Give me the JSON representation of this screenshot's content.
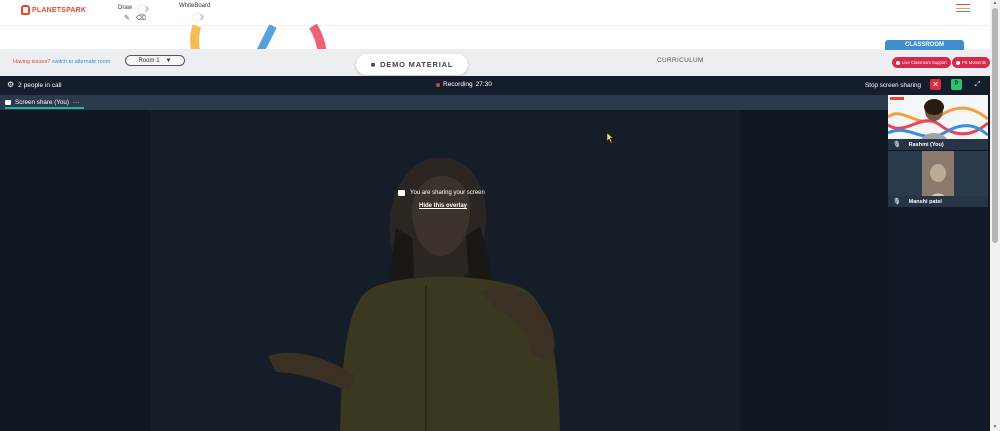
{
  "topbar": {
    "logo_text": "PLANETSPARK",
    "draw_label": "Draw",
    "whiteboard_label": "WhiteBoard",
    "tools": [
      "pencil-icon",
      "eraser-icon"
    ],
    "menu_colors": [
      "#e8452c",
      "#f2a03d",
      "#3a8fd6"
    ]
  },
  "roombar": {
    "issues_text": "Having issues?",
    "alternate_link": "switch to alternate room",
    "room_select": "Room 1",
    "demo_material": "DEMO MATERIAL",
    "curriculum": "CURRICULUM",
    "classroom_tab": "CLASSROOM",
    "live_support": "Live Classroom Support",
    "ps_moments": "PS Moments"
  },
  "call": {
    "people_count": "2 people in call",
    "recording_label": "Recording",
    "recording_time": "27:30",
    "stop_sharing": "Stop screen sharing",
    "p_badge": "P",
    "screen_tab": "Screen share (You)",
    "tab_more": "···",
    "overlay_message": "You are sharing your screen",
    "hide_overlay": "Hide this overlay"
  },
  "participants": [
    {
      "name": "Rashmi (You)"
    },
    {
      "name": "Manshi patel"
    }
  ],
  "colors": {
    "accent_red": "#e0263f",
    "accent_blue": "#3f8ed0",
    "accent_green": "#2ac46e",
    "call_bg": "#111926",
    "tab_underline": "#21b5a8"
  }
}
